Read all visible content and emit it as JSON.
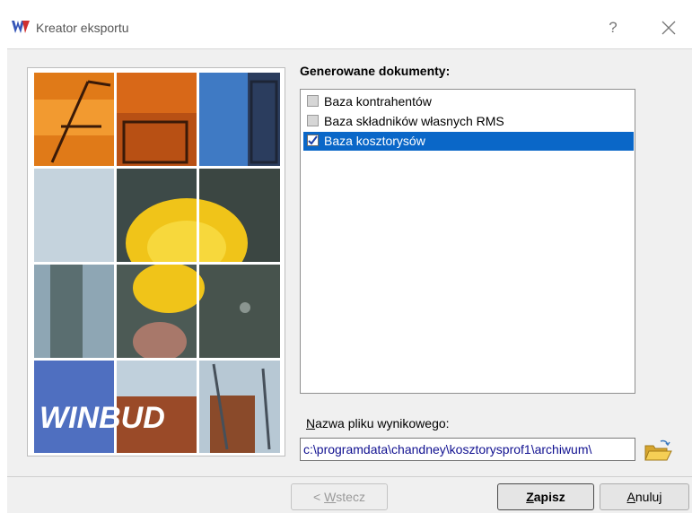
{
  "window": {
    "title": "Kreator eksportu",
    "help_glyph": "?"
  },
  "documents": {
    "label": "Generowane dokumenty:",
    "items": [
      {
        "label": "Baza kontrahentów",
        "checked": false,
        "selected": false
      },
      {
        "label": "Baza składników własnych RMS",
        "checked": false,
        "selected": false
      },
      {
        "label": "Baza kosztorysów",
        "checked": true,
        "selected": true
      }
    ]
  },
  "output_file": {
    "label_accel": "N",
    "label_rest": "azwa pliku wynikowego:",
    "value": "c:\\programdata\\chandney\\kosztorysprof1\\archiwum\\"
  },
  "picture": {
    "brand_text": "WINBUD"
  },
  "buttons": {
    "back": {
      "prefix": "< ",
      "accel": "W",
      "rest": "stecz"
    },
    "save": {
      "accel": "Z",
      "rest": "apisz"
    },
    "cancel": {
      "accel": "A",
      "rest": "nuluj"
    }
  },
  "colors": {
    "selection": "#0a67c8",
    "brand_blue": "#4f6fc0"
  }
}
